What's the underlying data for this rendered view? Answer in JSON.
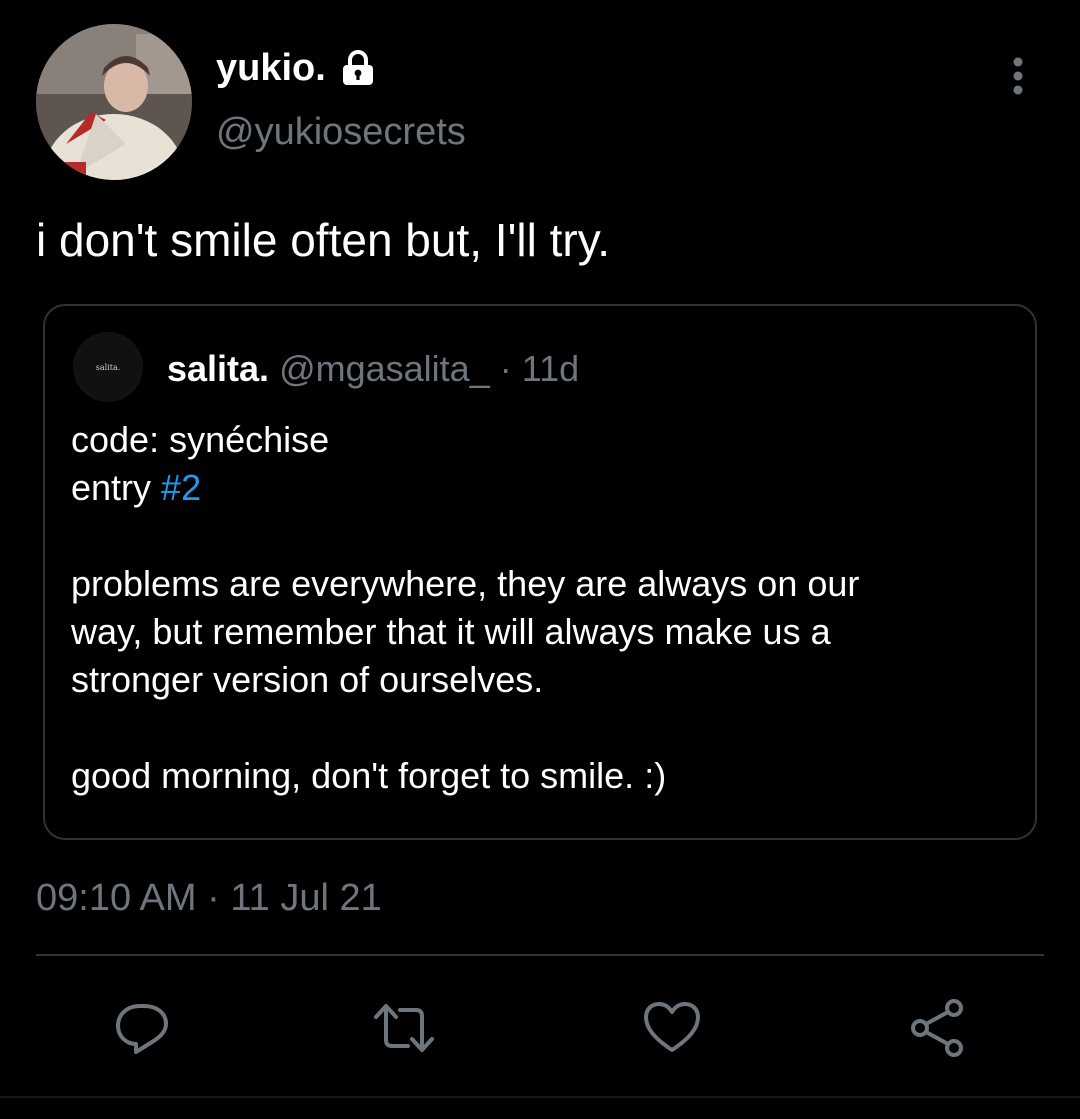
{
  "author": {
    "display_name": "yukio.",
    "handle": "@yukiosecrets",
    "protected_icon": "lock-icon"
  },
  "tweet": {
    "text": "i don't smile often but, I'll try.",
    "timestamp": "09:10 AM · 11 Jul 21"
  },
  "quoted_tweet": {
    "avatar_text": "salita.",
    "display_name": "salita.",
    "handle": "@mgasalita_",
    "time_sep": " · ",
    "age": "11d",
    "lines": {
      "code": "code: synéchise",
      "entry_prefix": "entry ",
      "entry_hashtag": "#2",
      "p1_l1": "problems are everywhere, they are always on our",
      "p1_l2": "way, but remember that it will always make us a",
      "p1_l3": "stronger version of ourselves.",
      "p2_l1": "good morning, don't forget to smile. :)"
    }
  },
  "actions": [
    {
      "icon": "reply-icon"
    },
    {
      "icon": "retweet-icon"
    },
    {
      "icon": "like-icon"
    },
    {
      "icon": "share-icon"
    }
  ],
  "colors": {
    "background": "#000000",
    "primary_text": "#ffffff",
    "secondary_text": "#6e767d",
    "link": "#1d9bf0",
    "border": "#2f3336",
    "icon": "#6e767d"
  }
}
